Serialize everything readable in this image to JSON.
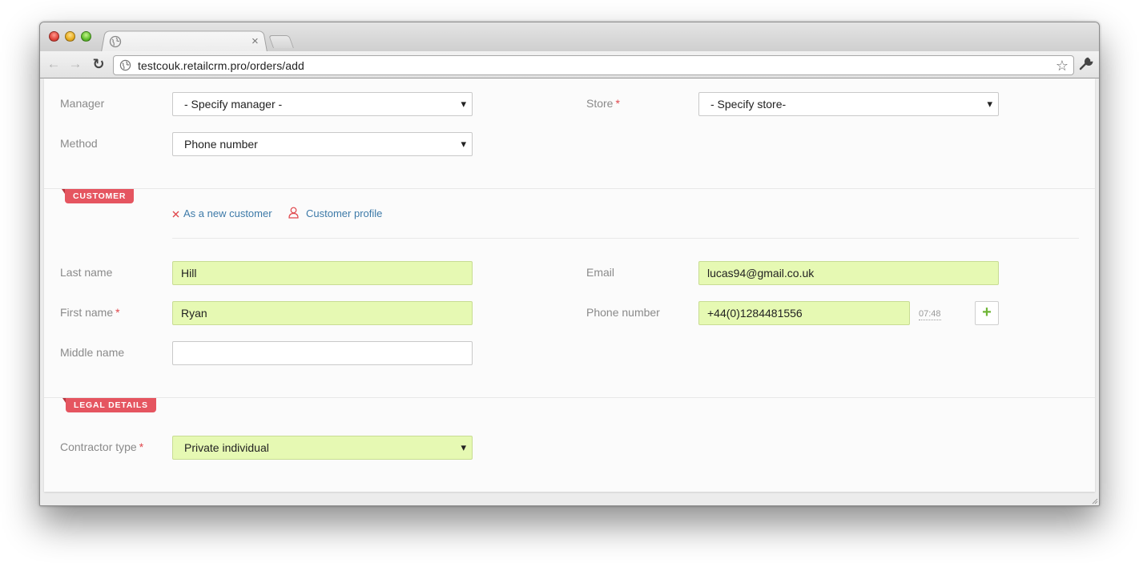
{
  "browser": {
    "url": "testcouk.retailcrm.pro/orders/add",
    "tab_close": "×"
  },
  "order": {
    "manager_label": "Manager",
    "manager_value": "- Specify manager -",
    "store_label": "Store",
    "store_value": "- Specify store-",
    "method_label": "Method",
    "method_value": "Phone number",
    "required_mark": "*"
  },
  "customer": {
    "section_title": "CUSTOMER",
    "new_customer_link": "As a new customer",
    "profile_link": "Customer profile",
    "last_name_label": "Last name",
    "last_name_value": "Hill",
    "first_name_label": "First name",
    "first_name_value": "Ryan",
    "middle_name_label": "Middle name",
    "middle_name_value": "",
    "email_label": "Email",
    "email_value": "lucas94@gmail.co.uk",
    "phone_label": "Phone number",
    "phone_value": "+44(0)1284481556",
    "phone_time": "07:48",
    "add_phone": "+"
  },
  "legal": {
    "section_title": "LEGAL DETAILS",
    "contractor_label": "Contractor type",
    "contractor_value": "Private individual"
  },
  "colors": {
    "accent": "#e55560",
    "filled_bg": "#e6f9b3",
    "link": "#3d7aa8",
    "add_green": "#6fb536"
  }
}
